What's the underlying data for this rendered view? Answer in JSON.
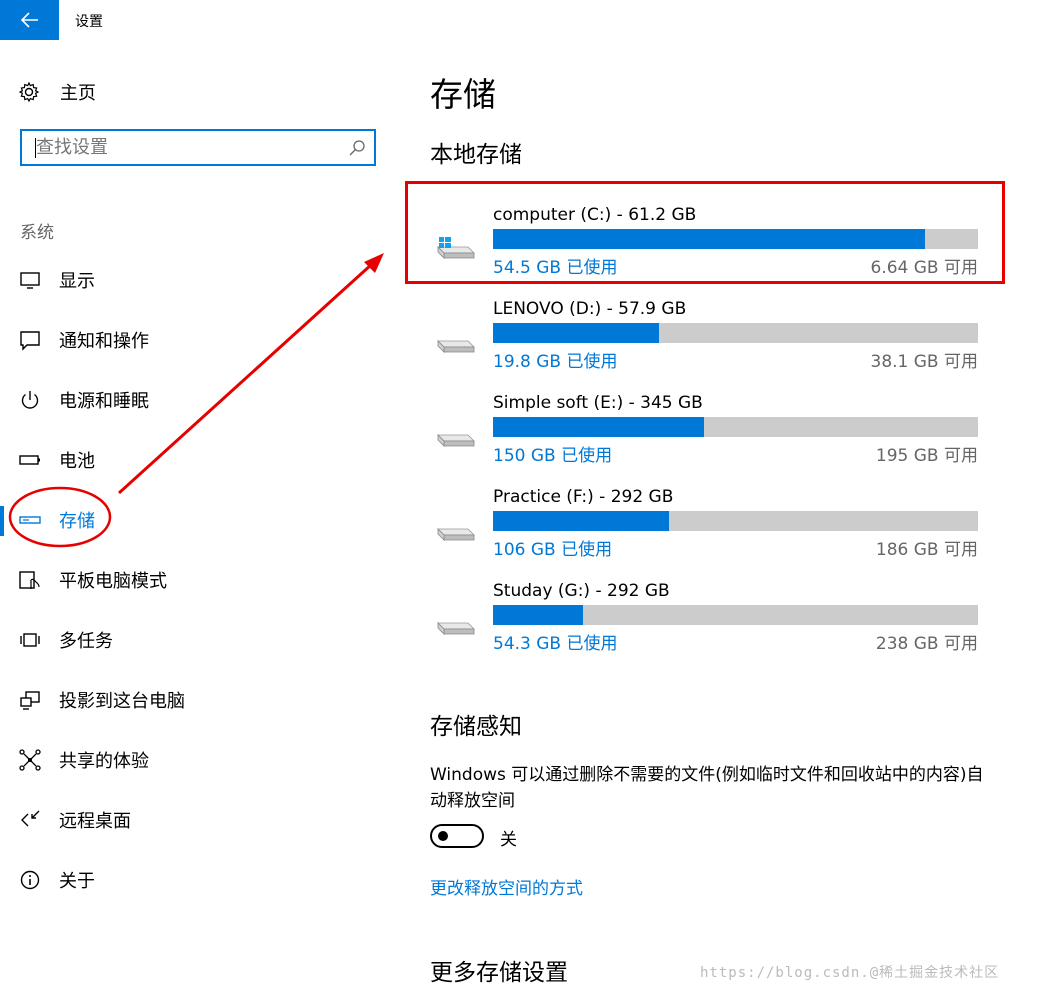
{
  "window": {
    "title": "设置",
    "back_icon": "back-arrow-icon",
    "accent": "#0078d7"
  },
  "sidebar": {
    "home_label": "主页",
    "search_placeholder": "查找设置",
    "section_label": "系统",
    "items": [
      {
        "label": "显示",
        "icon": "monitor-icon"
      },
      {
        "label": "通知和操作",
        "icon": "notification-icon"
      },
      {
        "label": "电源和睡眠",
        "icon": "power-icon"
      },
      {
        "label": "电池",
        "icon": "battery-icon"
      },
      {
        "label": "存储",
        "icon": "storage-icon",
        "active": true
      },
      {
        "label": "平板电脑模式",
        "icon": "tablet-mode-icon"
      },
      {
        "label": "多任务",
        "icon": "multitasking-icon"
      },
      {
        "label": "投影到这台电脑",
        "icon": "projecting-icon"
      },
      {
        "label": "共享的体验",
        "icon": "shared-experience-icon"
      },
      {
        "label": "远程桌面",
        "icon": "remote-desktop-icon"
      },
      {
        "label": "关于",
        "icon": "info-icon"
      }
    ]
  },
  "main": {
    "title": "存储",
    "local_storage_heading": "本地存储",
    "drives": [
      {
        "name": "computer (C:) - 61.2 GB",
        "used": "54.5 GB 已使用",
        "free": "6.64 GB 可用",
        "used_fraction": 0.891,
        "system": true
      },
      {
        "name": "LENOVO (D:) - 57.9 GB",
        "used": "19.8 GB 已使用",
        "free": "38.1 GB 可用",
        "used_fraction": 0.342
      },
      {
        "name": "Simple soft (E:) - 345 GB",
        "used": "150 GB 已使用",
        "free": "195 GB 可用",
        "used_fraction": 0.435
      },
      {
        "name": "Practice (F:) - 292 GB",
        "used": "106 GB 已使用",
        "free": "186 GB 可用",
        "used_fraction": 0.363
      },
      {
        "name": "Studay (G:) - 292 GB",
        "used": "54.3 GB 已使用",
        "free": "238 GB 可用",
        "used_fraction": 0.186
      }
    ],
    "storage_sense_heading": "存储感知",
    "storage_sense_desc": "Windows 可以通过删除不需要的文件(例如临时文件和回收站中的内容)自动释放空间",
    "toggle_label": "关",
    "toggle_on": false,
    "change_link": "更改释放空间的方式",
    "more_heading": "更多存储设置"
  },
  "watermark": "https://blog.csdn.@稀土掘金技术社区",
  "annotation_color": "#e60000"
}
